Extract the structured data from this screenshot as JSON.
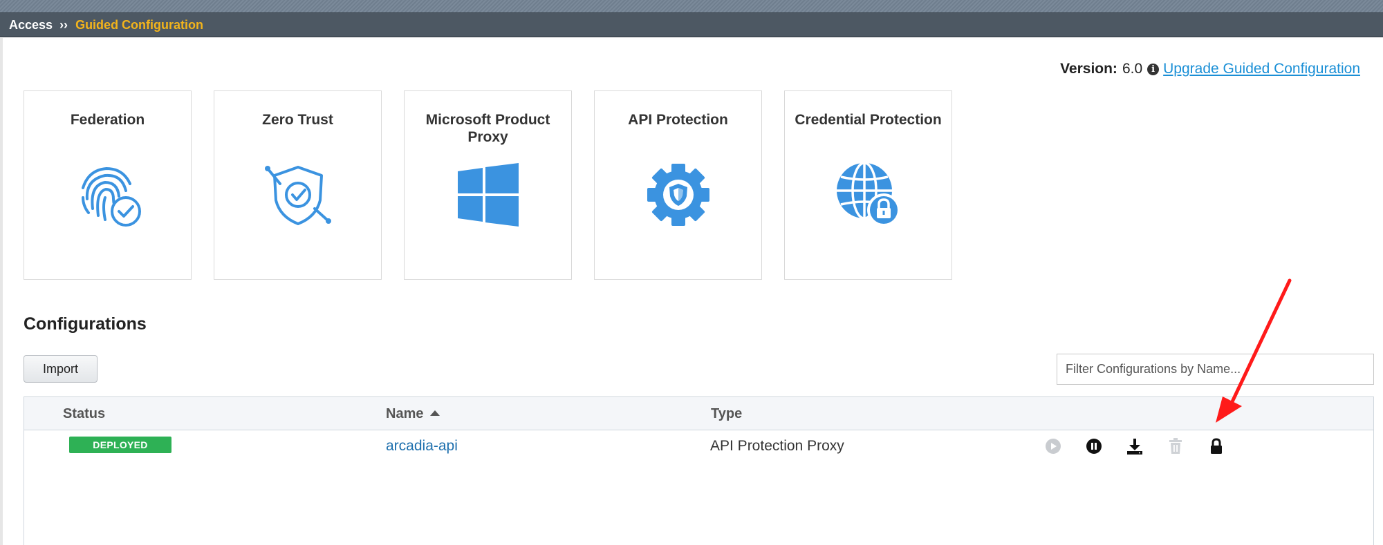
{
  "breadcrumb": {
    "section": "Access",
    "separator": "››",
    "current": "Guided Configuration"
  },
  "version": {
    "label": "Version:",
    "value": "6.0",
    "link": "Upgrade Guided Configuration"
  },
  "tiles": [
    {
      "title": "Federation",
      "icon": "fingerprint-check-icon"
    },
    {
      "title": "Zero Trust",
      "icon": "shield-check-icon"
    },
    {
      "title": "Microsoft Product Proxy",
      "icon": "windows-logo-icon"
    },
    {
      "title": "API Protection",
      "icon": "gear-shield-icon"
    },
    {
      "title": "Credential Protection",
      "icon": "globe-lock-icon"
    }
  ],
  "configurations": {
    "heading": "Configurations",
    "import_label": "Import",
    "filter_placeholder": "Filter Configurations by Name...",
    "columns": {
      "status": "Status",
      "name": "Name",
      "type": "Type"
    },
    "sort": {
      "column": "Name",
      "direction": "ascending"
    },
    "rows": [
      {
        "status": "DEPLOYED",
        "name": "arcadia-api",
        "type": "API Protection Proxy",
        "actions": [
          "play-icon",
          "pause-icon",
          "download-icon",
          "trash-icon",
          "lock-icon"
        ]
      }
    ]
  },
  "colors": {
    "header_bg": "#4d5863",
    "breadcrumb_current": "#f3b41b",
    "icon_blue": "#3b93e0",
    "deployed_green": "#2eb155",
    "link_blue": "#1a8fd6",
    "annotation_red": "#ff1a1a"
  }
}
